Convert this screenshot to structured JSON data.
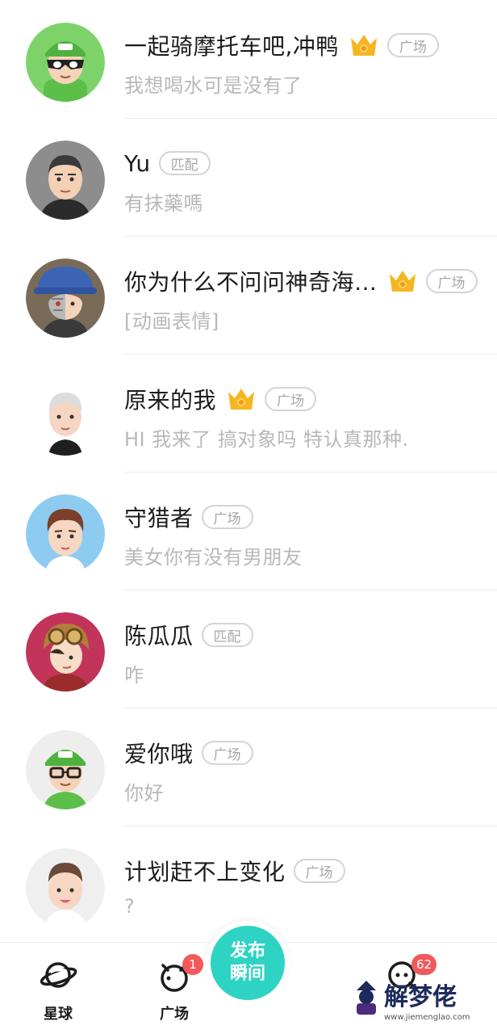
{
  "colors": {
    "accent": "#2ed3c3",
    "badge": "#f1595b",
    "crown": "#f6b623",
    "tag_border": "#d4d4d4"
  },
  "chats": [
    {
      "name": "一起骑摩托车吧,冲鸭",
      "message": "我想喝水可是没有了",
      "crown": true,
      "tag": "广场",
      "avatar": "green-cap-masked-avatar"
    },
    {
      "name": "Yu",
      "message": "有抹藥嗎",
      "crown": false,
      "tag": "匹配",
      "avatar": "buzzcut-man-avatar"
    },
    {
      "name": "你为什么不问问神奇海…",
      "message": "[动画表情]",
      "crown": true,
      "tag": "广场",
      "avatar": "half-robot-bucket-hat-avatar"
    },
    {
      "name": "原来的我",
      "message": "HI 我来了 搞对象吗 特认真那种.",
      "crown": true,
      "tag": "广场",
      "avatar": "white-hair-boy-avatar"
    },
    {
      "name": "守猎者",
      "message": "美女你有没有男朋友",
      "crown": false,
      "tag": "广场",
      "avatar": "brown-hair-boy-avatar"
    },
    {
      "name": "陈瓜瓜",
      "message": "咋",
      "crown": false,
      "tag": "匹配",
      "avatar": "aviator-goggles-avatar"
    },
    {
      "name": "爱你哦",
      "message": "你好",
      "crown": false,
      "tag": "广场",
      "avatar": "green-cap-glasses-avatar"
    },
    {
      "name": "计划赶不上变化",
      "message": "?",
      "crown": false,
      "tag": "广场",
      "avatar": "smiling-boy-avatar"
    }
  ],
  "tabbar": {
    "tabs": [
      {
        "label": "星球",
        "icon": "planet-icon"
      },
      {
        "label": "广场",
        "icon": "square-icon",
        "badge": "1"
      },
      {
        "label": "",
        "icon": "chat-icon",
        "badge": "62"
      }
    ],
    "publish": {
      "line1": "发布",
      "line2": "瞬间"
    }
  },
  "watermark": {
    "text": "解梦佬",
    "url": "www.jiemenglao.com"
  }
}
